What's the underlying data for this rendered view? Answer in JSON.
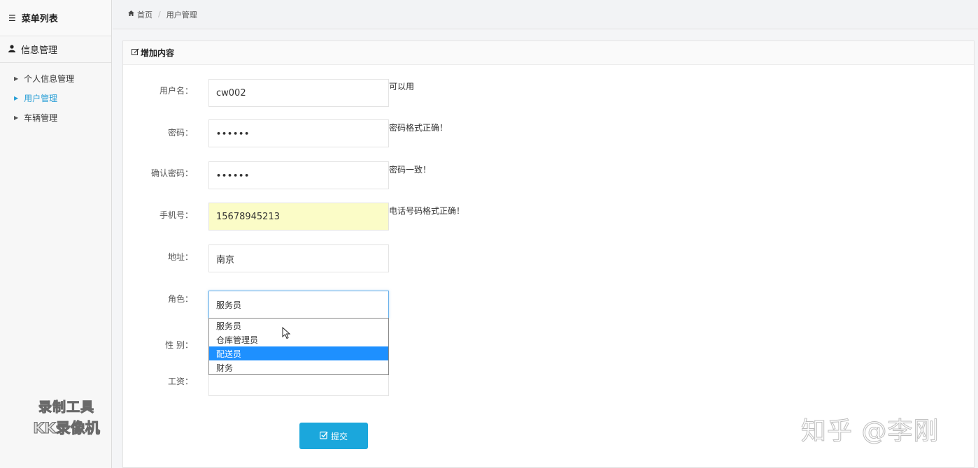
{
  "sidebar": {
    "header": {
      "title": "菜单列表",
      "icon": "list-icon"
    },
    "group": {
      "title": "信息管理",
      "icon": "user-icon"
    },
    "items": [
      {
        "label": "个人信息管理",
        "active": false
      },
      {
        "label": "用户管理",
        "active": true
      },
      {
        "label": "车辆管理",
        "active": false
      }
    ],
    "watermark": {
      "line1": "录制工具",
      "line2": "KK录像机"
    }
  },
  "breadcrumb": {
    "home": "首页",
    "current": "用户管理"
  },
  "panel": {
    "title": "增加内容",
    "icon": "edit-icon"
  },
  "form": {
    "username": {
      "label": "用户名：",
      "value": "cw002",
      "hint": "可以用"
    },
    "password": {
      "label": "密码：",
      "value": "••••••",
      "hint": "密码格式正确！"
    },
    "confirm": {
      "label": "确认密码：",
      "value": "••••••",
      "hint": "密码一致！"
    },
    "phone": {
      "label": "手机号：",
      "value": "15678945213",
      "hint": "电话号码格式正确！"
    },
    "address": {
      "label": "地址：",
      "value": "南京"
    },
    "role": {
      "label": "角色：",
      "selected": "服务员",
      "options": [
        "服务员",
        "仓库管理员",
        "配送员",
        "财务"
      ],
      "highlighted_index": 2
    },
    "gender": {
      "label": "性 别："
    },
    "salary": {
      "label": "工资：",
      "value": ""
    },
    "submit": {
      "label": "提交",
      "icon": "check-square-icon"
    }
  },
  "overlay_watermark": "知乎 @李刚",
  "colors": {
    "accent": "#1ba7dc",
    "highlight": "#1e90ff",
    "autofill": "#fbfcc7"
  }
}
